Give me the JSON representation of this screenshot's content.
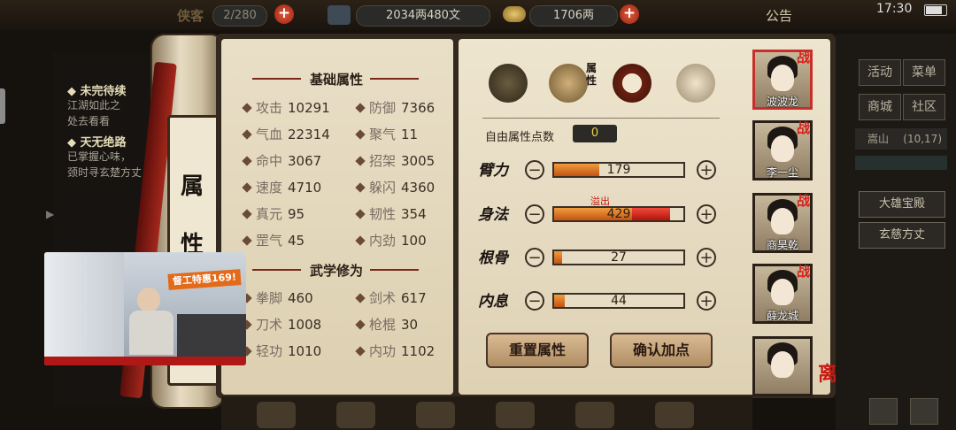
{
  "topbar": {
    "truncated_title": "侠客",
    "capacity": "2/280",
    "money": "2034两480文",
    "gold": "1706两",
    "notice": "公告",
    "time": "17:30"
  },
  "quests": [
    {
      "title": "◆ 未完待续",
      "body": [
        "江湖如此之",
        "处去看看"
      ]
    },
    {
      "title": "◆ 天无绝路",
      "body": [
        "已掌握心味，",
        "颈时寻玄楚方丈"
      ]
    }
  ],
  "roll_chars": [
    "属",
    "性"
  ],
  "basic_title": "基础属性",
  "basic_stats": [
    {
      "name": "攻击",
      "value": "10291"
    },
    {
      "name": "防御",
      "value": "7366"
    },
    {
      "name": "气血",
      "value": "22314"
    },
    {
      "name": "聚气",
      "value": "11"
    },
    {
      "name": "命中",
      "value": "3067"
    },
    {
      "name": "招架",
      "value": "3005"
    },
    {
      "name": "速度",
      "value": "4710"
    },
    {
      "name": "躲闪",
      "value": "4360"
    },
    {
      "name": "真元",
      "value": "95"
    },
    {
      "name": "韧性",
      "value": "354"
    },
    {
      "name": "罡气",
      "value": "45"
    },
    {
      "name": "内劲",
      "value": "100"
    }
  ],
  "martial_title": "武学修为",
  "martial_stats": [
    {
      "name": "拳脚",
      "value": "460"
    },
    {
      "name": "剑术",
      "value": "617"
    },
    {
      "name": "刀术",
      "value": "1008"
    },
    {
      "name": "枪棍",
      "value": "30"
    },
    {
      "name": "轻功",
      "value": "1010"
    },
    {
      "name": "内功",
      "value": "1102"
    }
  ],
  "tab_label": "属性",
  "free_points_label": "自由属性点数",
  "free_points": "0",
  "attributes": [
    {
      "label": "臂力",
      "value": "179",
      "fraction": 0.35,
      "over": 0
    },
    {
      "label": "身法",
      "value": "429",
      "fraction": 0.6,
      "over": 0.3
    },
    {
      "label": "根骨",
      "value": "27",
      "fraction": 0.06,
      "over": 0
    },
    {
      "label": "内息",
      "value": "44",
      "fraction": 0.08,
      "over": 0
    }
  ],
  "overflow_label": "溢出",
  "buttons": {
    "reset": "重置属性",
    "confirm": "确认加点"
  },
  "team": [
    {
      "name": "波波龙",
      "battle": "战"
    },
    {
      "name": "李一尘",
      "battle": "战"
    },
    {
      "name": "商昊乾",
      "battle": "战"
    },
    {
      "name": "薛龙城",
      "battle": "战"
    },
    {
      "name": "",
      "battle": ""
    }
  ],
  "leave_label": "离开",
  "right_menu": {
    "buttons": [
      "活动",
      "菜单",
      "商城",
      "社区"
    ],
    "location": "嵩山",
    "coords": "(10,17)",
    "places": [
      "大雄宝殿",
      "玄慈方丈"
    ]
  },
  "video": {
    "banner": "督工特惠169!"
  },
  "colors": {
    "accent_red": "#c7302a",
    "bar_orange": "#e07a28",
    "parchment": "#e9dfc7"
  }
}
